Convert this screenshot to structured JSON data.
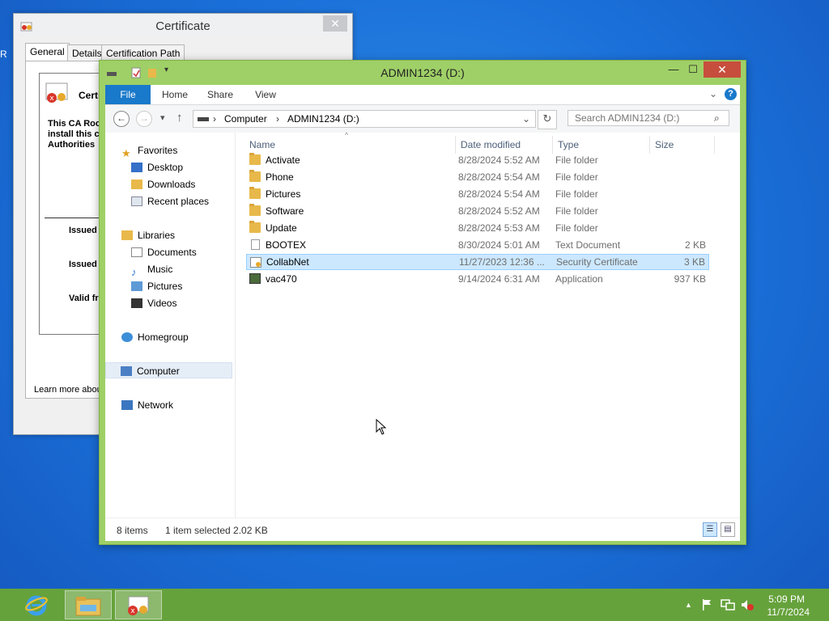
{
  "colors": {
    "accent": "#1979ca",
    "explorer_frame": "#9fd067",
    "taskbar": "#66a23c",
    "selection": "#cce8ff",
    "close_red": "#c74e3d"
  },
  "desktop": {
    "peek_text": "R"
  },
  "cert_window": {
    "title": "Certificate",
    "close_glyph": "✕",
    "tabs": [
      "General",
      "Details",
      "Certification Path"
    ],
    "header_partial": "Certi",
    "body_partial": [
      "This CA Roo",
      "install this c",
      "Authorities"
    ],
    "fields_partial": [
      "Issued",
      "Issued",
      "Valid fr"
    ],
    "learn_more_partial": "Learn more abou"
  },
  "explorer": {
    "title": "ADMIN1234 (D:)",
    "caption": {
      "minimize": "—",
      "maximize": "☐",
      "close": "✕"
    },
    "ribbon_tabs": [
      "File",
      "Home",
      "Share",
      "View"
    ],
    "help": "?",
    "collapse_glyph": "⌄",
    "nav": {
      "back": "←",
      "forward": "→",
      "recent": "▾",
      "up": "↑",
      "refresh": "↻"
    },
    "address": {
      "sep": "›",
      "segments": [
        "Computer",
        "ADMIN1234 (D:)"
      ],
      "dropdown": "⌄"
    },
    "search_placeholder": "Search ADMIN1234 (D:)",
    "search_icon": "⌕",
    "nav_pane": {
      "favorites": "Favorites",
      "favorites_items": [
        "Desktop",
        "Downloads",
        "Recent places"
      ],
      "libraries": "Libraries",
      "libraries_items": [
        "Documents",
        "Music",
        "Pictures",
        "Videos"
      ],
      "homegroup": "Homegroup",
      "computer": "Computer",
      "network": "Network"
    },
    "columns": {
      "name": "Name",
      "date": "Date modified",
      "type": "Type",
      "size": "Size",
      "sort_glyph": "^"
    },
    "files": [
      {
        "name": "Activate",
        "date": "8/28/2024 5:52 AM",
        "type": "File folder",
        "size": "",
        "icon": "folder-icon"
      },
      {
        "name": "Phone",
        "date": "8/28/2024 5:54 AM",
        "type": "File folder",
        "size": "",
        "icon": "folder-icon"
      },
      {
        "name": "Pictures",
        "date": "8/28/2024 5:54 AM",
        "type": "File folder",
        "size": "",
        "icon": "folder-icon"
      },
      {
        "name": "Software",
        "date": "8/28/2024 5:52 AM",
        "type": "File folder",
        "size": "",
        "icon": "folder-icon"
      },
      {
        "name": "Update",
        "date": "8/28/2024 5:53 AM",
        "type": "File folder",
        "size": "",
        "icon": "folder-icon"
      },
      {
        "name": "BOOTEX",
        "date": "8/30/2024 5:01 AM",
        "type": "Text Document",
        "size": "2 KB",
        "icon": "text-document-icon"
      },
      {
        "name": "CollabNet",
        "date": "11/27/2023 12:36 ...",
        "type": "Security Certificate",
        "size": "3 KB",
        "icon": "certificate-icon",
        "selected": true
      },
      {
        "name": "vac470",
        "date": "9/14/2024 6:31 AM",
        "type": "Application",
        "size": "937 KB",
        "icon": "application-icon"
      }
    ],
    "status": {
      "count": "8 items",
      "selection": "1 item selected  2.02 KB"
    }
  },
  "taskbar": {
    "tray_arrow": "▲",
    "time": "5:09 PM",
    "date": "11/7/2024"
  }
}
